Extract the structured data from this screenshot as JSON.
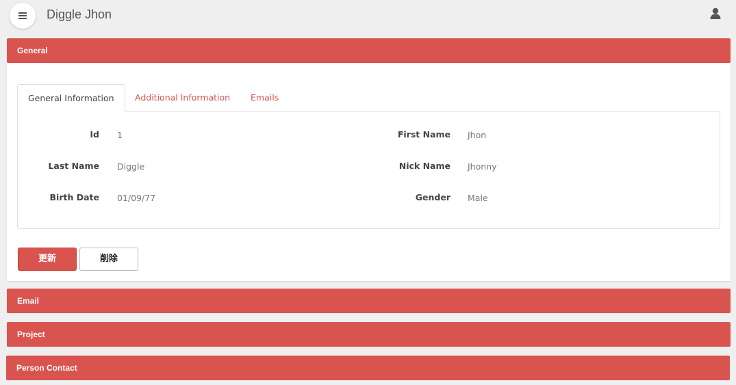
{
  "header": {
    "title": "Diggle Jhon"
  },
  "panels": {
    "general": {
      "label": "General"
    },
    "email": {
      "label": "Email"
    },
    "project": {
      "label": "Project"
    },
    "person_contact": {
      "label": "Person Contact"
    }
  },
  "tabs": [
    {
      "label": "General Information",
      "active": true
    },
    {
      "label": "Additional Information",
      "active": false
    },
    {
      "label": "Emails",
      "active": false
    }
  ],
  "fields": {
    "id": {
      "label": "Id",
      "value": "1"
    },
    "first_name": {
      "label": "First Name",
      "value": "Jhon"
    },
    "last_name": {
      "label": "Last Name",
      "value": "Diggle"
    },
    "nick_name": {
      "label": "Nick Name",
      "value": "Jhonny"
    },
    "birth_date": {
      "label": "Birth Date",
      "value": "01/09/77"
    },
    "gender": {
      "label": "Gender",
      "value": "Male"
    }
  },
  "actions": {
    "update_label": "更新",
    "delete_label": "削除"
  },
  "icons": {
    "menu": "hamburger-icon",
    "user": "user-icon"
  },
  "colors": {
    "accent": "#d9534f",
    "background": "#efefef"
  }
}
